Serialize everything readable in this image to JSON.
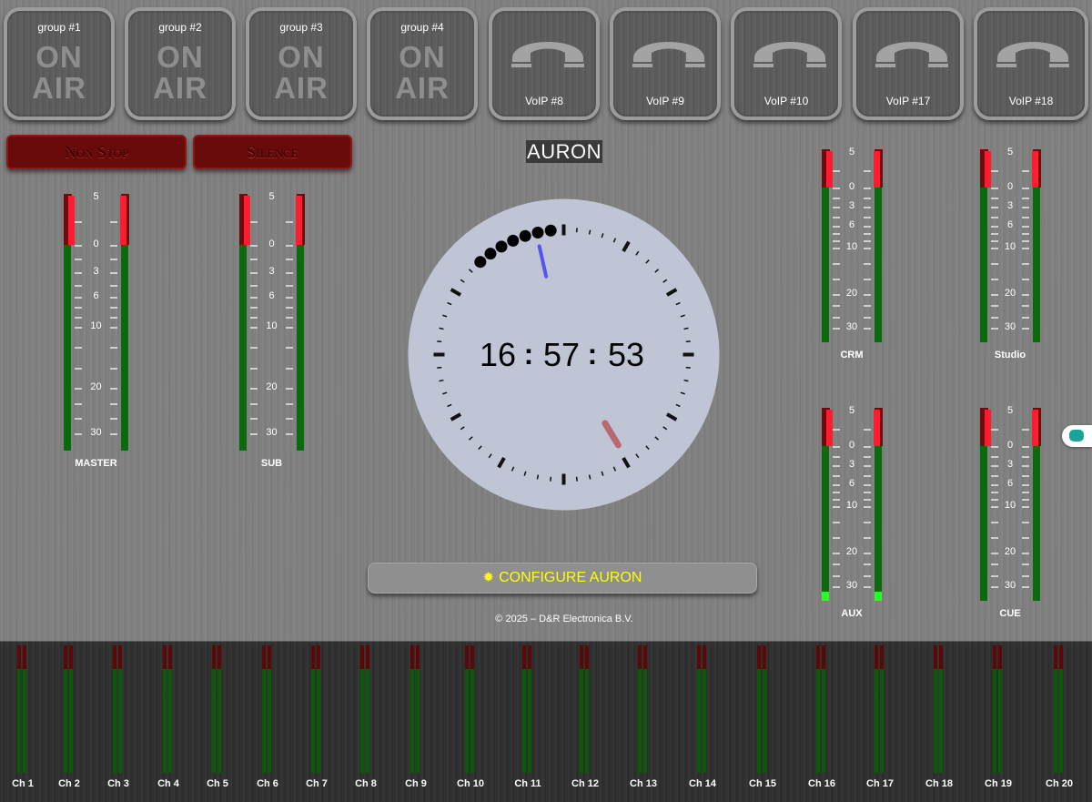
{
  "groups": [
    {
      "label": "group #1",
      "status": "ON AIR"
    },
    {
      "label": "group #2",
      "status": "ON AIR"
    },
    {
      "label": "group #3",
      "status": "ON AIR"
    },
    {
      "label": "group #4",
      "status": "ON AIR"
    }
  ],
  "voip": [
    {
      "label": "VoIP #8",
      "icon": "phone-hangup-icon"
    },
    {
      "label": "VoIP #9",
      "icon": "phone-hangup-icon"
    },
    {
      "label": "VoIP #10",
      "icon": "phone-hangup-icon"
    },
    {
      "label": "VoIP #17",
      "icon": "phone-hangup-icon"
    },
    {
      "label": "VoIP #18",
      "icon": "phone-hangup-icon"
    }
  ],
  "buttons": {
    "non_stop": "Non Stop",
    "silence": "Silence"
  },
  "logo": "AURON",
  "meters": {
    "scale_tall": [
      "5",
      "0",
      "3",
      "6",
      "10",
      "20",
      "30"
    ],
    "scale_small": [
      "5",
      "0",
      "3",
      "6",
      "10",
      "20",
      "30"
    ],
    "master": {
      "label": "MASTER"
    },
    "sub": {
      "label": "SUB"
    },
    "crm": {
      "label": "CRM"
    },
    "studio": {
      "label": "Studio"
    },
    "aux": {
      "label": "AUX"
    },
    "cue": {
      "label": "CUE"
    }
  },
  "clock": {
    "hours": "16",
    "minutes": "57",
    "seconds": "53",
    "sep": ":",
    "hour_value": 16,
    "minute_value": 57,
    "second_value": 53
  },
  "configure": {
    "label": "CONFIGURE AURON",
    "icon": "gear-icon"
  },
  "copyright": "© 2025 – D&R Electronica B.V.",
  "channels": [
    "Ch 1",
    "Ch 2",
    "Ch 3",
    "Ch 4",
    "Ch 5",
    "Ch 6",
    "Ch 7",
    "Ch 8",
    "Ch 9",
    "Ch 10",
    "Ch 11",
    "Ch 12",
    "Ch 13",
    "Ch 14",
    "Ch 15",
    "Ch 16",
    "Ch 17",
    "Ch 18",
    "Ch 19",
    "Ch 20"
  ],
  "colors": {
    "meter_green": "#0b6a0b",
    "meter_red": "#ff1b30",
    "signal_green": "#22ff22",
    "config_text": "#ffff00",
    "clock_face": "#c0c5d6"
  }
}
